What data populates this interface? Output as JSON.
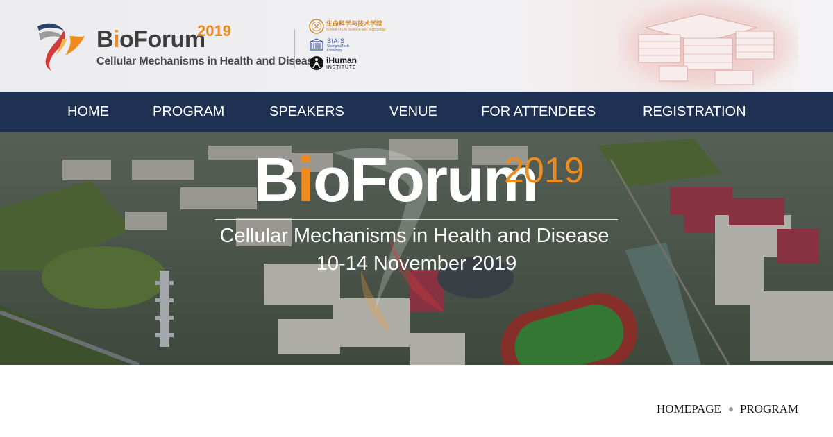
{
  "header": {
    "brand_name_pre": "B",
    "brand_name_accent": "i",
    "brand_name_post": "oForum",
    "brand_year": "2019",
    "brand_subtitle": "Cellular Mechanisms in Health and Disease",
    "partners": {
      "slst_cn": "生命科学与技术学院",
      "slst_en": "School of Life Science and Technology",
      "siais_name": "SIAIS",
      "siais_sub1": "ShanghaiTech",
      "siais_sub2": "University",
      "ihuman_name": "iHuman",
      "ihuman_sub": "INSTITUTE"
    }
  },
  "nav": {
    "items": [
      {
        "label": "HOME"
      },
      {
        "label": "PROGRAM"
      },
      {
        "label": "SPEAKERS"
      },
      {
        "label": "VENUE"
      },
      {
        "label": "FOR ATTENDEES"
      },
      {
        "label": "REGISTRATION"
      }
    ]
  },
  "hero": {
    "title_pre": "B",
    "title_accent": "i",
    "title_post": "oForum",
    "year": "2019",
    "subtitle": "Cellular Mechanisms in Health and Disease",
    "dates": "10-14 November 2019"
  },
  "breadcrumb": {
    "items": [
      "HOMEPAGE",
      "PROGRAM"
    ]
  },
  "colors": {
    "nav_bg": "#1f3152",
    "accent_orange": "#ef8a1c",
    "header_bg": "#ececee"
  }
}
